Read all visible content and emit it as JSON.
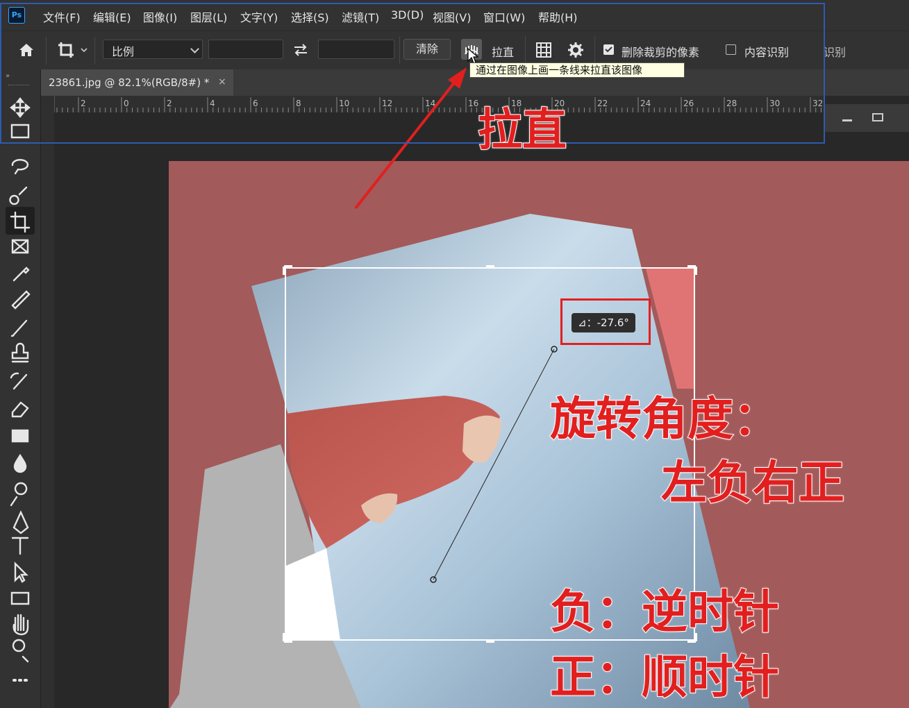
{
  "menu": {
    "logo": "Ps",
    "items": [
      "文件(F)",
      "编辑(E)",
      "图像(I)",
      "图层(L)",
      "文字(Y)",
      "选择(S)",
      "滤镜(T)",
      "3D(D)",
      "视图(V)",
      "窗口(W)",
      "帮助(H)"
    ]
  },
  "options": {
    "ratio_value": "比例",
    "clear_label": "清除",
    "straighten_label": "拉直",
    "delete_cropped_label": "删除裁剪的像素",
    "delete_cropped_checked": true,
    "content_aware_label": "内容识别",
    "content_aware_checked": false,
    "hidden_partial_label": "识别"
  },
  "tooltip": "通过在图像上画一条线来拉直该图像",
  "document": {
    "tab_title": "23861.jpg @ 82.1%(RGB/8#) *",
    "close_glyph": "×"
  },
  "ruler": {
    "labels": [
      "2",
      "0",
      "2",
      "4",
      "6",
      "8",
      "10",
      "12",
      "14",
      "16",
      "18",
      "20",
      "22",
      "24",
      "26",
      "28",
      "30",
      "32"
    ]
  },
  "canvas": {
    "angle_readout": "-27.6°",
    "angle_symbol": "⊿："
  },
  "annotations": {
    "straighten_heading": "拉直",
    "rotation_title": "旋转角度：",
    "rotation_rule": "左负右正",
    "negative_rule": "负：逆时针",
    "positive_rule": "正：顺时针"
  },
  "colors": {
    "accent_red": "#e21f1f",
    "artboard": "#a35a5a",
    "ui_dark": "#323232"
  },
  "tools": [
    "move-icon",
    "marquee-icon",
    "lasso-icon",
    "quick-select-icon",
    "crop-icon",
    "frame-icon",
    "eyedropper-icon",
    "healing-icon",
    "brush-icon",
    "stamp-icon",
    "history-brush-icon",
    "eraser-icon",
    "gradient-icon",
    "blur-icon",
    "dodge-icon",
    "pen-icon",
    "type-icon",
    "path-select-icon",
    "rectangle-icon",
    "hand-icon",
    "zoom-icon",
    "more-icon"
  ]
}
